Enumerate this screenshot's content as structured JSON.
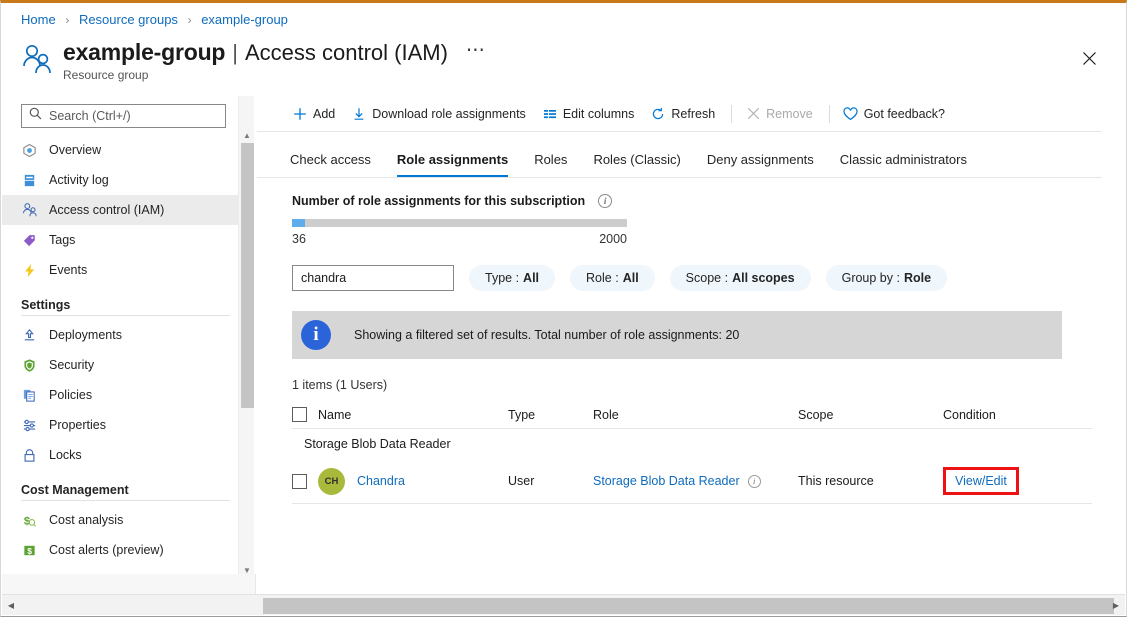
{
  "breadcrumb": {
    "items": [
      "Home",
      "Resource groups",
      "example-group"
    ],
    "separator": "›"
  },
  "header": {
    "title_strong": "example-group",
    "title_divider": "|",
    "title_light": "Access control (IAM)",
    "ellipsis": "⋯",
    "subtitle": "Resource group",
    "close_label": "✕"
  },
  "sidebar": {
    "search": {
      "value": "",
      "placeholder": "Search (Ctrl+/)"
    },
    "collapse_label": "«",
    "items": [
      {
        "label": "Overview",
        "icon": "overview-icon",
        "active": false
      },
      {
        "label": "Activity log",
        "icon": "activity-log-icon",
        "active": false
      },
      {
        "label": "Access control (IAM)",
        "icon": "access-control-icon",
        "active": true
      },
      {
        "label": "Tags",
        "icon": "tags-icon",
        "active": false
      },
      {
        "label": "Events",
        "icon": "events-icon",
        "active": false
      }
    ],
    "group_settings": {
      "label": "Settings",
      "items": [
        {
          "label": "Deployments",
          "icon": "deployments-icon"
        },
        {
          "label": "Security",
          "icon": "security-icon"
        },
        {
          "label": "Policies",
          "icon": "policies-icon"
        },
        {
          "label": "Properties",
          "icon": "properties-icon"
        },
        {
          "label": "Locks",
          "icon": "locks-icon"
        }
      ]
    },
    "group_cost": {
      "label": "Cost Management",
      "items": [
        {
          "label": "Cost analysis",
          "icon": "cost-analysis-icon"
        },
        {
          "label": "Cost alerts (preview)",
          "icon": "cost-alerts-icon"
        }
      ]
    }
  },
  "toolbar": {
    "add": "Add",
    "download": "Download role assignments",
    "edit_columns": "Edit columns",
    "refresh": "Refresh",
    "remove": "Remove",
    "feedback": "Got feedback?"
  },
  "tabs": [
    {
      "label": "Check access",
      "active": false
    },
    {
      "label": "Role assignments",
      "active": true
    },
    {
      "label": "Roles",
      "active": false
    },
    {
      "label": "Roles (Classic)",
      "active": false
    },
    {
      "label": "Deny assignments",
      "active": false
    },
    {
      "label": "Classic administrators",
      "active": false
    }
  ],
  "progress": {
    "title": "Number of role assignments for this subscription",
    "info": "i",
    "current": "36",
    "max": "2000",
    "fill_percent": 4,
    "fill_color": "#61aceb"
  },
  "filters": {
    "search_value": "chandra",
    "search_placeholder": "",
    "pills": [
      {
        "label": "Type :",
        "value": "All"
      },
      {
        "label": "Role :",
        "value": "All"
      },
      {
        "label": "Scope :",
        "value": "All scopes"
      },
      {
        "label": "Group by :",
        "value": "Role"
      }
    ]
  },
  "info_banner": {
    "icon": "i",
    "text": "Showing a filtered set of results. Total number of role assignments: 20"
  },
  "table": {
    "items_count": "1 items (1 Users)",
    "columns": [
      "Name",
      "Type",
      "Role",
      "Scope",
      "Condition"
    ],
    "group_header": "Storage Blob Data Reader",
    "rows": [
      {
        "avatar_initials": "CH",
        "avatar_color": "#a8b93c",
        "name": "Chandra",
        "type": "User",
        "role": "Storage Blob Data Reader",
        "role_info": "i",
        "scope": "This resource",
        "condition": "View/Edit",
        "condition_highlight_color": "#ee1212"
      }
    ]
  },
  "scrollbars": {
    "up_arrow": "▲",
    "down_arrow": "▼",
    "left_arrow": "◀",
    "right_arrow": "▶"
  }
}
